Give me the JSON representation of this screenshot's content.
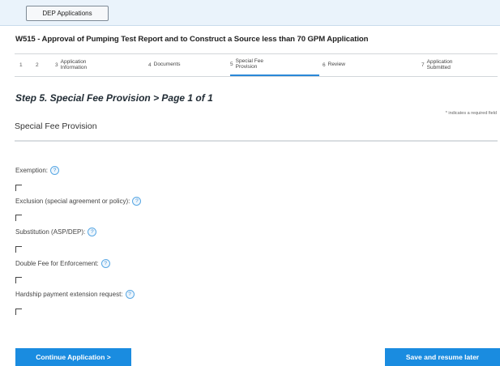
{
  "header": {
    "dep_button": "DEP Applications"
  },
  "app_title": "W515 - Approval of Pumping Test Report and to Construct a Source less than 70 GPM Application",
  "steps": [
    {
      "num": "1",
      "label": ""
    },
    {
      "num": "2",
      "label": ""
    },
    {
      "num": "3",
      "label": "Application Information"
    },
    {
      "num": "4",
      "label": "Documents"
    },
    {
      "num": "5",
      "label": "Special Fee Provision"
    },
    {
      "num": "6",
      "label": "Review"
    },
    {
      "num": "7",
      "label": "Application Submitted"
    }
  ],
  "step_title": "Step 5. Special Fee Provision > Page 1 of 1",
  "required_note": "* indicates a required field",
  "section_heading": "Special Fee Provision",
  "fields": [
    {
      "label": "Exemption:",
      "checked": false
    },
    {
      "label": "Exclusion (special agreement or policy):",
      "checked": false
    },
    {
      "label": "Substitution (ASP/DEP):",
      "checked": false
    },
    {
      "label": "Double Fee for Enforcement:",
      "checked": false
    },
    {
      "label": "Hardship payment extension request:",
      "checked": false
    }
  ],
  "buttons": {
    "continue": "Continue Application >",
    "save": "Save and resume later"
  },
  "colors": {
    "accent": "#1a8ce0",
    "topbar": "#eaf3fb"
  }
}
